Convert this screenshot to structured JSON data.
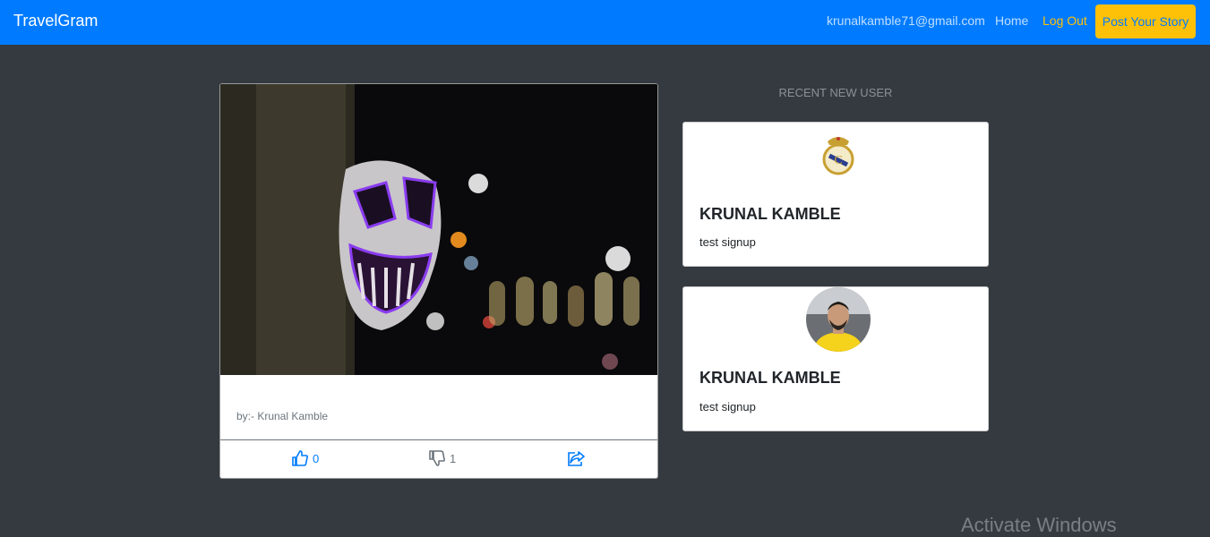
{
  "navbar": {
    "brand": "TravelGram",
    "email": "krunalkamble71@gmail.com",
    "home": "Home",
    "logout": "Log Out",
    "post_story": "Post Your Story"
  },
  "story": {
    "author": "by:- Krunal Kamble",
    "likes": "0",
    "dislikes": "1"
  },
  "recent": {
    "title": "RECENT NEW USER",
    "users": [
      {
        "name": "KRUNAL KAMBLE",
        "bio": "test signup",
        "avatar": "crest-icon"
      },
      {
        "name": "KRUNAL KAMBLE",
        "bio": "test signup",
        "avatar": "profile-photo"
      }
    ]
  },
  "watermark": "Activate Windows",
  "colors": {
    "primary": "#007bff",
    "warning": "#ffc107",
    "dark": "#343a40"
  }
}
